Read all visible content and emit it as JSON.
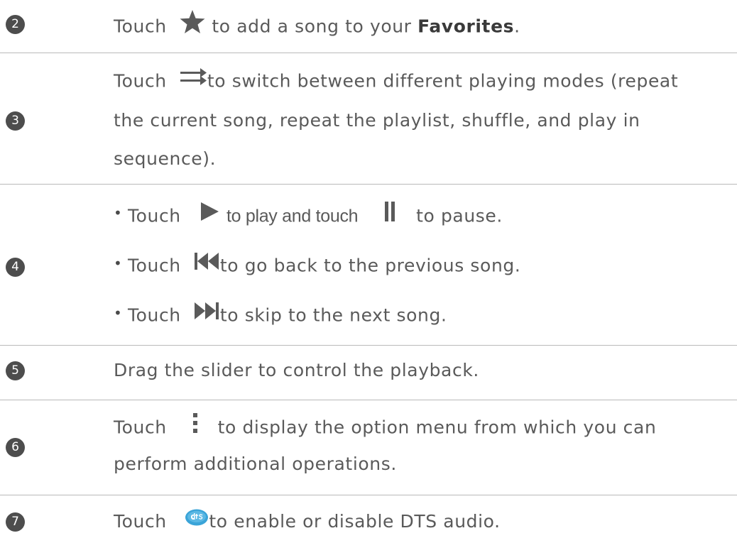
{
  "icon_colors": {
    "badge": "#4d4d4d",
    "icon": "#5a5a5a",
    "dts": "#3aa4d8"
  },
  "rows": {
    "r2": {
      "num": "2",
      "touch": "Touch",
      "before_bold": "to add a song to your",
      "bold": "Favorites",
      "end": "."
    },
    "r3": {
      "num": "3",
      "touch": "Touch",
      "line1": "to switch between different playing modes (repeat",
      "line2": "the current song, repeat the playlist, shuffle, and play in",
      "line3": "sequence)."
    },
    "r4": {
      "num": "4",
      "b1_touch": "Touch",
      "b1_play": "to play and touch",
      "b1_pause": "to pause.",
      "b2_touch": "Touch",
      "b2_text": "to go back to the previous song.",
      "b3_touch": "Touch",
      "b3_text": "to skip to the next song."
    },
    "r5": {
      "num": "5",
      "text": "Drag the slider to control the playback."
    },
    "r6": {
      "num": "6",
      "touch": "Touch",
      "line1": "to display the option menu from which you can",
      "line2": "perform additional operations."
    },
    "r7": {
      "num": "7",
      "touch": "Touch",
      "text": "to enable or disable DTS audio."
    }
  }
}
